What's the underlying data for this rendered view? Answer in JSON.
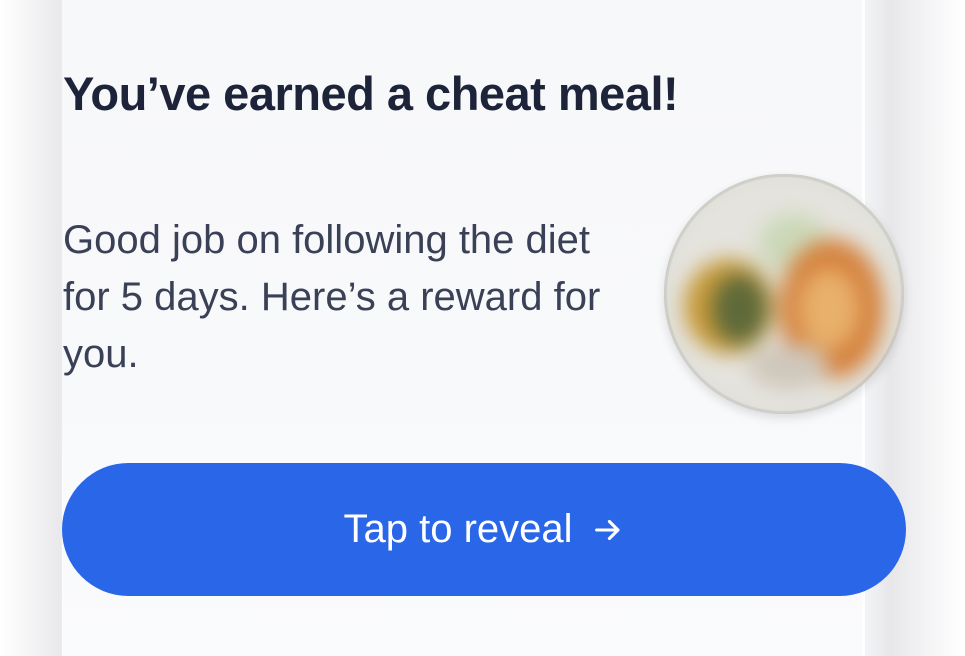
{
  "reward_card": {
    "title": "You’ve earned a cheat meal!",
    "message": "Good job on following the diet for 5 days. Here’s a reward for you.",
    "image": {
      "icon": "blurred-food-plate-image"
    },
    "cta": {
      "label": "Tap to reveal",
      "icon": "arrow-right-icon"
    }
  },
  "colors": {
    "accent": "#2966e8",
    "title_text": "#1d2338",
    "body_text": "#3a4156",
    "card_background": "#f8f9fb"
  }
}
